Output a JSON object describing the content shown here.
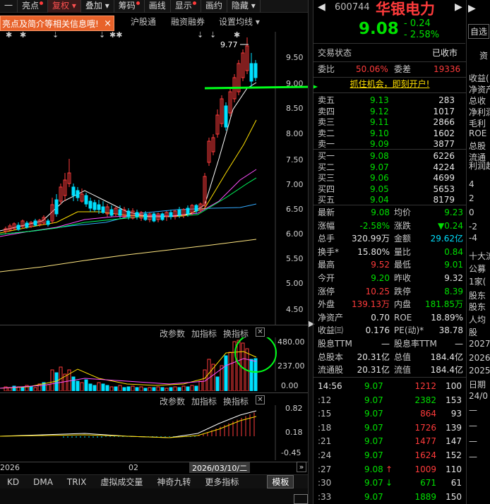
{
  "toolbar": {
    "items": [
      "一",
      "亮点",
      "复权",
      "叠加",
      "筹码",
      "画线",
      "显示",
      "画约",
      "隐藏"
    ],
    "sub_items": [
      "沪股通",
      "融资融券",
      "设置均线"
    ],
    "tip": "亮点及简介等相关信息哦!",
    "tip_close": "×"
  },
  "price_axis": [
    "9.50",
    "9.00",
    "8.50",
    "8.00",
    "7.50",
    "7.00",
    "6.50",
    "6.00",
    "5.50",
    "5.00",
    "4.50"
  ],
  "high_marker": "9.77",
  "volume": {
    "labels": [
      "改参数",
      "加指标",
      "换指标"
    ],
    "axis": [
      "480.00",
      "237.00",
      "0.00"
    ]
  },
  "macd": {
    "labels": [
      "改参数",
      "加指标",
      "换指标"
    ],
    "axis": [
      "0.82",
      "0.18",
      "-0.45"
    ]
  },
  "date_axis": {
    "left": "2026",
    "mid": "02",
    "current": "2026/03/10/二",
    "nav": "»"
  },
  "bottom_tabs": [
    "KD",
    "DMA",
    "TRIX",
    "虚拟成交量",
    "神奇九转",
    "更多指标",
    "模板"
  ],
  "stock": {
    "code": "600744",
    "name": "华银电力",
    "price": "9.08",
    "change": "- 0.24",
    "change_pct": "- 2.58%",
    "status_label": "交易状态",
    "status": "已收市",
    "ratio_label": "委比",
    "ratio": "50.06%",
    "diff_label": "委差",
    "diff": "19336",
    "promo": "抓住机会，即刻开户!"
  },
  "sell_orders": [
    {
      "label": "卖五",
      "price": "9.13",
      "vol": "283"
    },
    {
      "label": "卖四",
      "price": "9.12",
      "vol": "1017"
    },
    {
      "label": "卖三",
      "price": "9.11",
      "vol": "2866"
    },
    {
      "label": "卖二",
      "price": "9.10",
      "vol": "1602"
    },
    {
      "label": "卖一",
      "price": "9.09",
      "vol": "3877"
    }
  ],
  "buy_orders": [
    {
      "label": "买一",
      "price": "9.08",
      "vol": "6226"
    },
    {
      "label": "买二",
      "price": "9.07",
      "vol": "4224"
    },
    {
      "label": "买三",
      "price": "9.06",
      "vol": "4699"
    },
    {
      "label": "买四",
      "price": "9.05",
      "vol": "5653"
    },
    {
      "label": "买五",
      "price": "9.04",
      "vol": "8179"
    }
  ],
  "stats": [
    [
      "最新",
      "9.08",
      "均价",
      "9.23"
    ],
    [
      "涨幅",
      "-2.58%",
      "涨跌",
      "▼0.24"
    ],
    [
      "总手",
      "320.99万",
      "金额",
      "29.62亿"
    ],
    [
      "换手*",
      "15.80%",
      "量比",
      "0.84"
    ],
    [
      "最高",
      "9.52",
      "最低",
      "9.01"
    ],
    [
      "今开",
      "9.20",
      "昨收",
      "9.32"
    ],
    [
      "涨停",
      "10.25",
      "跌停",
      "8.39"
    ],
    [
      "外盘",
      "139.13万",
      "内盘",
      "181.85万"
    ],
    [
      "净资产",
      "0.70",
      "ROE",
      "18.89%"
    ],
    [
      "收益㈢",
      "0.176",
      "PE(动)*",
      "38.78"
    ],
    [
      "股息TTM",
      "—",
      "股息率TTM",
      "—"
    ],
    [
      "总股本",
      "20.31亿",
      "总值",
      "184.4亿"
    ],
    [
      "流通股",
      "20.31亿",
      "流值",
      "184.4亿"
    ]
  ],
  "ticks": [
    {
      "time": "14:56",
      "price": "9.07",
      "vol": "1212",
      "n": "100",
      "arrow": ""
    },
    {
      "time": ":12",
      "price": "9.07",
      "vol": "2382",
      "n": "153",
      "arrow": ""
    },
    {
      "time": ":15",
      "price": "9.07",
      "vol": "864",
      "n": "93",
      "arrow": ""
    },
    {
      "time": ":18",
      "price": "9.07",
      "vol": "1726",
      "n": "139",
      "arrow": ""
    },
    {
      "time": ":21",
      "price": "9.07",
      "vol": "1477",
      "n": "147",
      "arrow": ""
    },
    {
      "time": ":24",
      "price": "9.07",
      "vol": "1624",
      "n": "152",
      "arrow": ""
    },
    {
      "time": ":27",
      "price": "9.08",
      "vol": "1009",
      "n": "110",
      "arrow": "↑"
    },
    {
      "time": ":30",
      "price": "9.07",
      "vol": "671",
      "n": "61",
      "arrow": "↓"
    },
    {
      "time": ":33",
      "price": "9.07",
      "vol": "1889",
      "n": "150",
      "arrow": ""
    }
  ],
  "far_right": {
    "top_btn": "自选",
    "side_tab": "资",
    "items": [
      "收益(",
      "净资产",
      "总收",
      "净利润",
      "毛利",
      "ROE",
      "总股",
      "流通",
      "利润趋",
      "4",
      "2",
      "0",
      "-2",
      "-4",
      "十大流",
      "公募",
      "1家(",
      "股东",
      "股东",
      "人均",
      "股",
      "2027",
      "2026",
      "2025",
      "日期",
      "24/0",
      "—",
      "—",
      "—",
      "—"
    ]
  },
  "colors": {
    "up": "#ff3b3b",
    "down": "#00e000",
    "ma5": "#ffffff",
    "ma10": "#ffe000",
    "ma20": "#ff4fff",
    "ma30": "#00ff60",
    "ma60": "#33aaff",
    "tip_bg": "#e8622a",
    "annotation": "#00ff1a"
  }
}
